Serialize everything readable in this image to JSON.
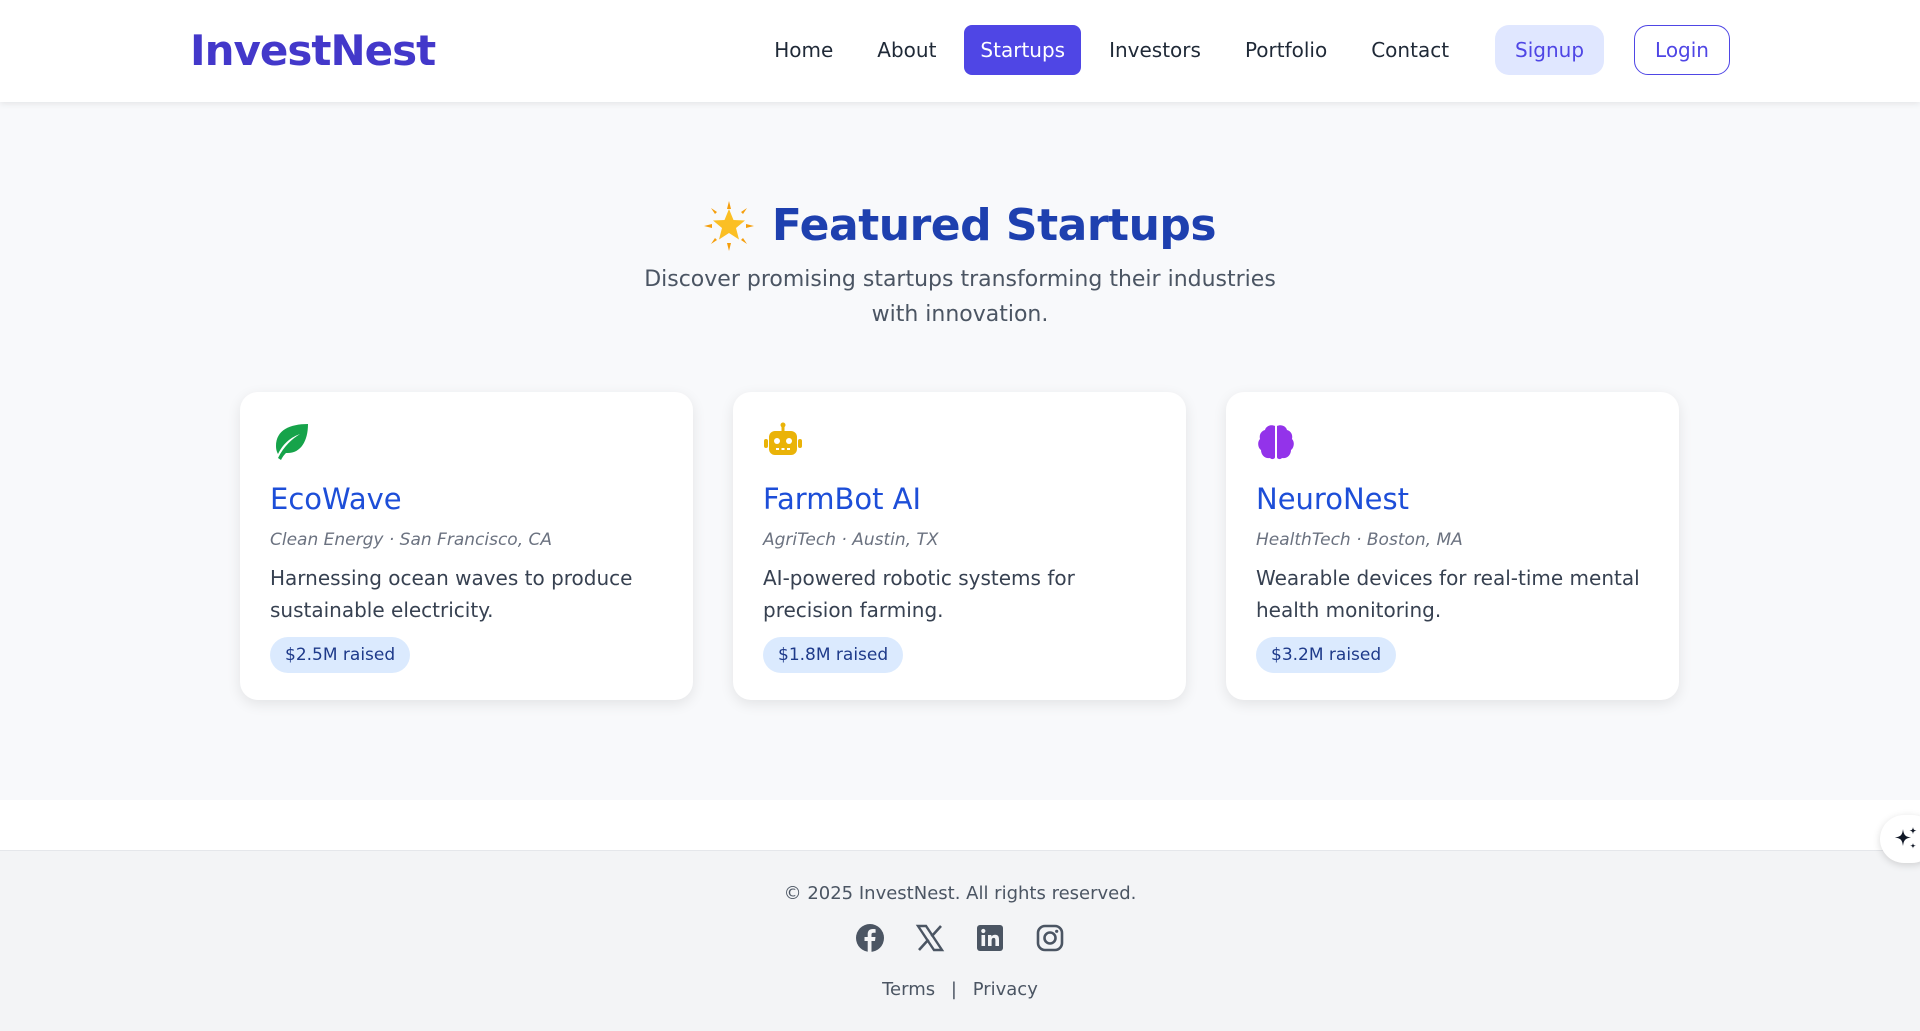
{
  "header": {
    "logo": "InvestNest",
    "nav": [
      "Home",
      "About",
      "Startups",
      "Investors",
      "Portfolio",
      "Contact"
    ],
    "active_nav": "Startups",
    "signup_label": "Signup",
    "login_label": "Login"
  },
  "section": {
    "icon": "star-icon",
    "title": "Featured Startups",
    "subtitle": "Discover promising startups transforming their industries with innovation."
  },
  "cards": [
    {
      "icon": "leaf-icon",
      "icon_color": "#16a34a",
      "name": "EcoWave",
      "meta": "Clean Energy · San Francisco, CA",
      "description": "Harnessing ocean waves to produce sustainable electricity.",
      "raised": "$2.5M raised"
    },
    {
      "icon": "robot-icon",
      "icon_color": "#eab308",
      "name": "FarmBot AI",
      "meta": "AgriTech · Austin, TX",
      "description": "AI-powered robotic systems for precision farming.",
      "raised": "$1.8M raised"
    },
    {
      "icon": "brain-icon",
      "icon_color": "#9333ea",
      "name": "NeuroNest",
      "meta": "HealthTech · Boston, MA",
      "description": "Wearable devices for real-time mental health monitoring.",
      "raised": "$3.2M raised"
    }
  ],
  "footer": {
    "copyright": "© 2025 InvestNest. All rights reserved.",
    "socials": [
      "facebook-icon",
      "x-icon",
      "linkedin-icon",
      "instagram-icon"
    ],
    "links": [
      "Terms",
      "Privacy"
    ],
    "separator": "|"
  },
  "colors": {
    "brand": "#4338ca",
    "accent": "#4f46e5",
    "title": "#1e40af",
    "card_name": "#1d4ed8",
    "badge_bg": "#dbeafe"
  }
}
